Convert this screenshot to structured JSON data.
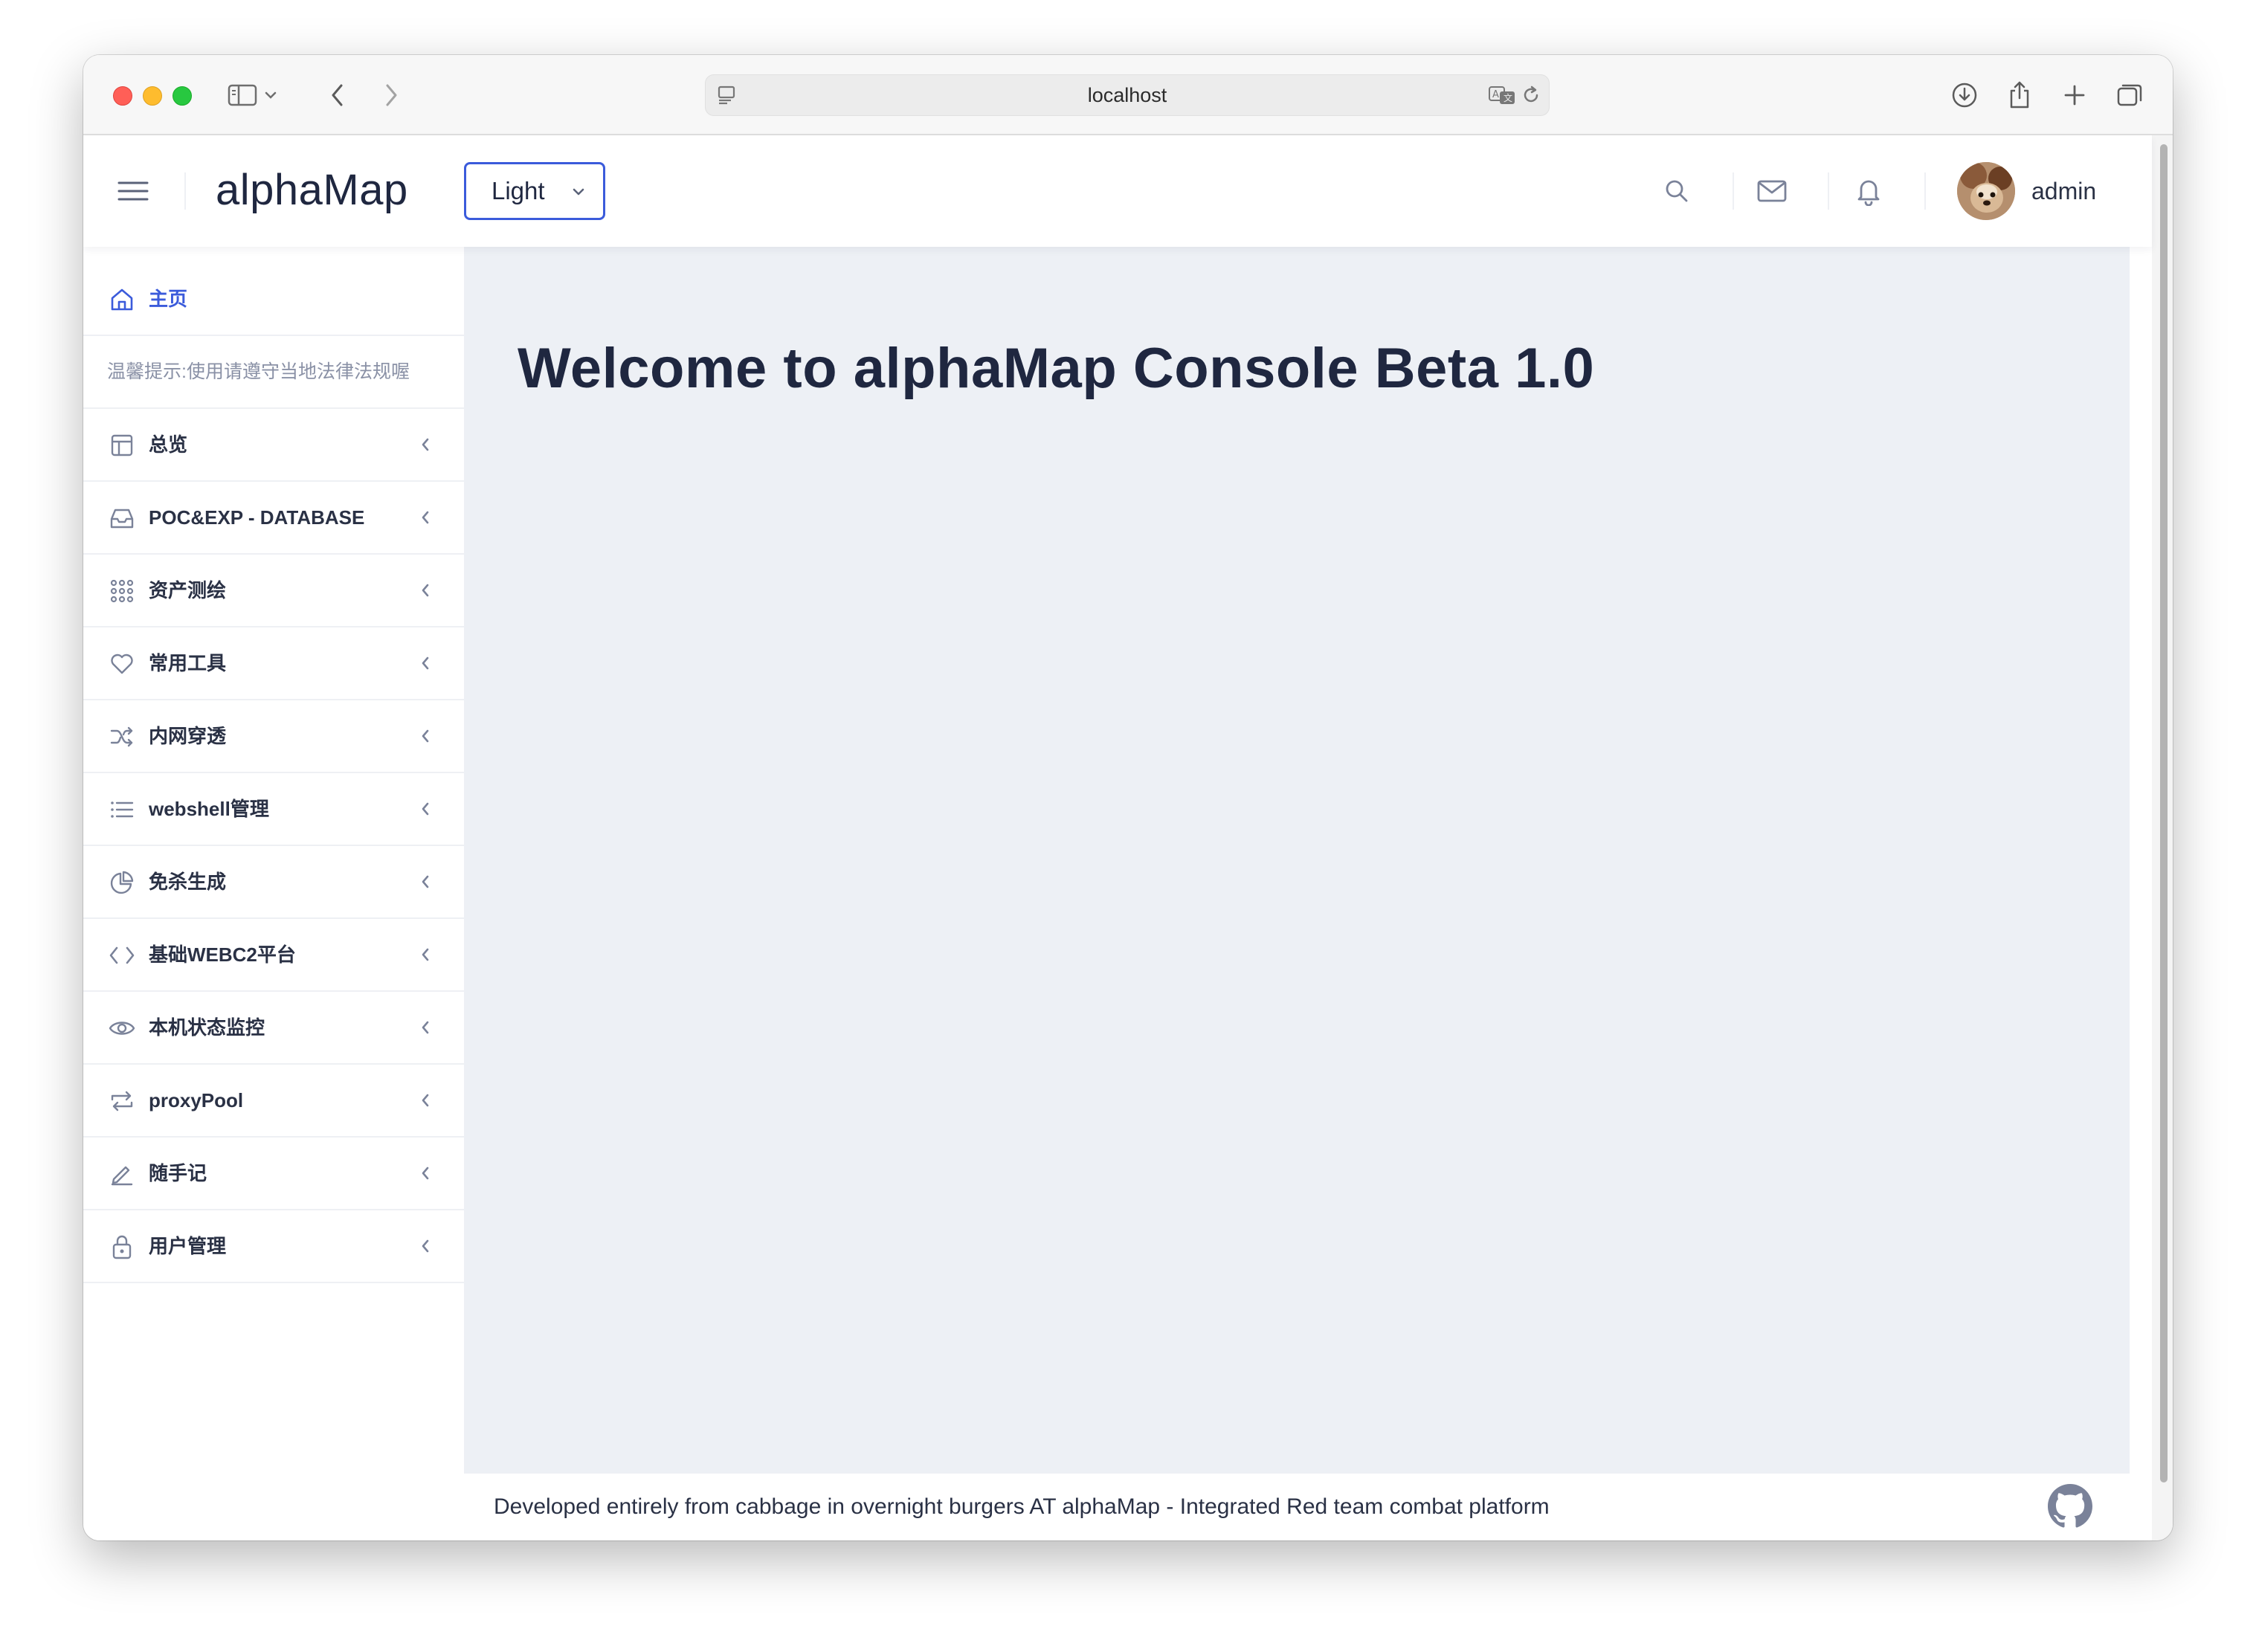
{
  "browser": {
    "url": "localhost"
  },
  "header": {
    "brand": "alphaMap",
    "theme_value": "Light",
    "username": "admin"
  },
  "sidebar": {
    "home_label": "主页",
    "notice": "温馨提示:使用请遵守当地法律法规喔",
    "items": [
      {
        "label": "总览",
        "icon": "layout-icon"
      },
      {
        "label": "POC&EXP - DATABASE",
        "icon": "inbox-icon"
      },
      {
        "label": "资产测绘",
        "icon": "grid-dots-icon"
      },
      {
        "label": "常用工具",
        "icon": "heart-icon"
      },
      {
        "label": "内网穿透",
        "icon": "shuffle-icon"
      },
      {
        "label": "webshell管理",
        "icon": "list-icon"
      },
      {
        "label": "免杀生成",
        "icon": "pie-chart-icon"
      },
      {
        "label": "基础WEBC2平台",
        "icon": "code-icon"
      },
      {
        "label": "本机状态监控",
        "icon": "eye-icon"
      },
      {
        "label": "proxyPool",
        "icon": "repeat-icon"
      },
      {
        "label": "随手记",
        "icon": "edit-icon"
      },
      {
        "label": "用户管理",
        "icon": "lock-icon"
      }
    ]
  },
  "main": {
    "welcome": "Welcome to alphaMap Console Beta 1.0"
  },
  "footer": {
    "text": "Developed entirely from cabbage in overnight burgers AT alphaMap - Integrated Red team combat platform"
  },
  "colors": {
    "accent": "#3b5bdb",
    "text": "#1f2740",
    "content_bg": "#edf0f5"
  }
}
